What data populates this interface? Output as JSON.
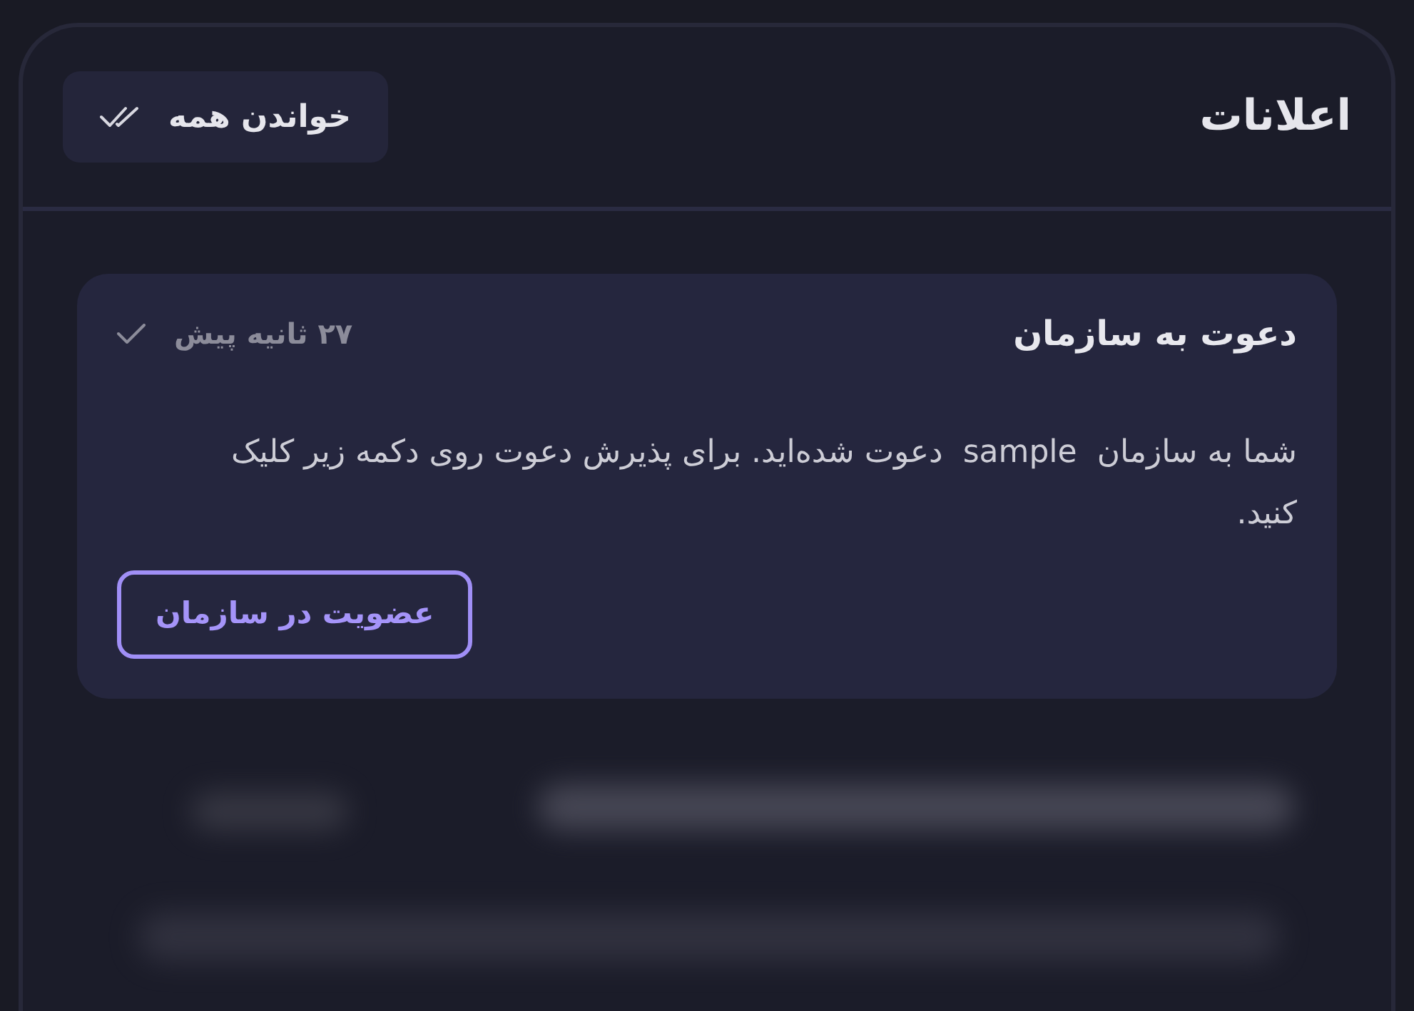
{
  "header": {
    "title": "اعلانات",
    "mark_all_read_button": "خواندن همه"
  },
  "notifications": [
    {
      "title": "دعوت به سازمان",
      "time": "۲۷ ثانیه پیش",
      "read": true,
      "body": "شما به سازمان  sample  دعوت شده‌اید. برای پذیرش دعوت روی دکمه زیر کلیک کنید.",
      "action_button": "عضویت در سازمان"
    }
  ]
}
